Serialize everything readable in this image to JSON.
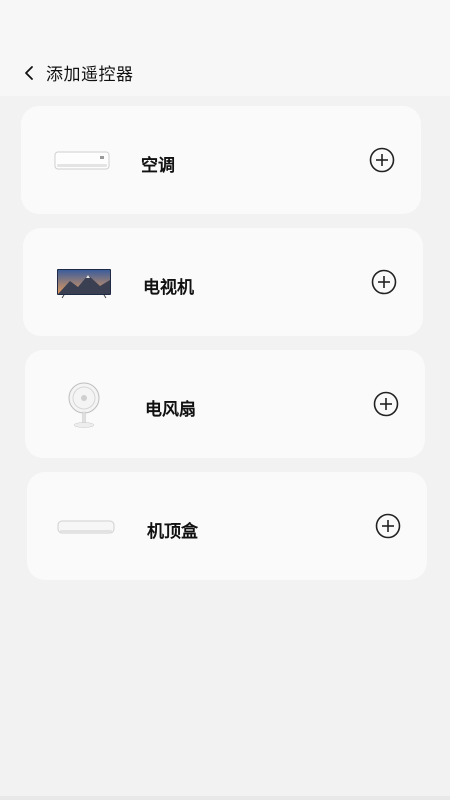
{
  "header": {
    "title": "添加遥控器"
  },
  "devices": [
    {
      "label": "空调"
    },
    {
      "label": "电视机"
    },
    {
      "label": "电风扇"
    },
    {
      "label": "机顶盒"
    }
  ]
}
